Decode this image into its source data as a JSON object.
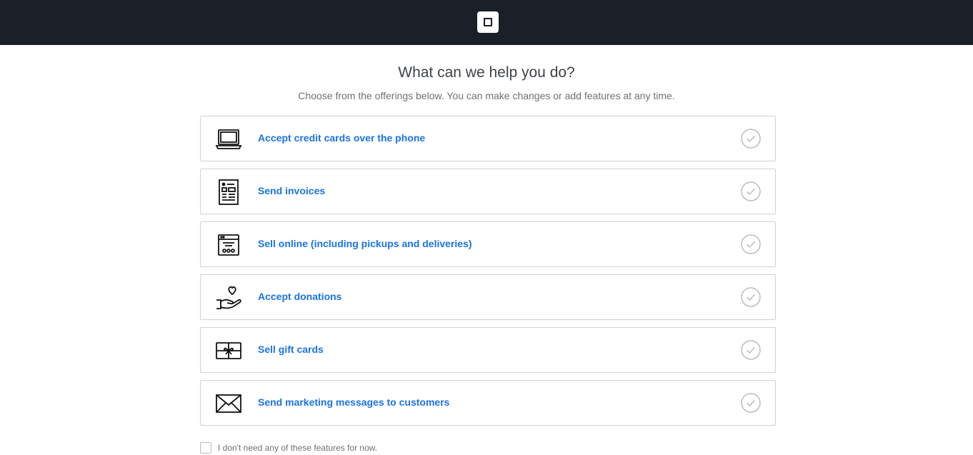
{
  "header": {
    "logo_icon": "square-logo-icon",
    "background": "#1b1f27"
  },
  "main": {
    "title": "What can we help you do?",
    "subtitle": "Choose from the offerings below. You can make changes or add features at any time."
  },
  "options": [
    {
      "label": "Accept credit cards over the phone",
      "icon": "laptop-icon",
      "selected": false
    },
    {
      "label": "Send invoices",
      "icon": "invoice-icon",
      "selected": false
    },
    {
      "label": "Sell online (including pickups and deliveries)",
      "icon": "online-store-icon",
      "selected": false
    },
    {
      "label": "Accept donations",
      "icon": "heart-hand-icon",
      "selected": false
    },
    {
      "label": "Sell gift cards",
      "icon": "gift-card-icon",
      "selected": false
    },
    {
      "label": "Send marketing messages to customers",
      "icon": "envelope-icon",
      "selected": false
    }
  ],
  "optout": {
    "label": "I don't need any of these features for now.",
    "checked": false
  },
  "colors": {
    "accent": "#1a73e8",
    "border": "#cfd2d5",
    "check": "#b9bdc1"
  }
}
